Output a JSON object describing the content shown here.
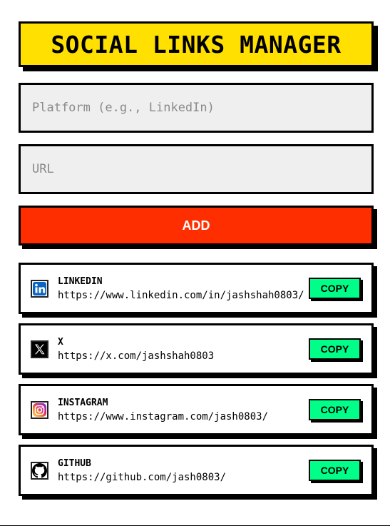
{
  "app": {
    "title": "SOCIAL LINKS MANAGER"
  },
  "form": {
    "platform_placeholder": "Platform (e.g., LinkedIn)",
    "platform_value": "",
    "url_placeholder": "URL",
    "url_value": "",
    "add_label": "ADD"
  },
  "links": [
    {
      "name": "LINKEDIN",
      "url": "https://www.linkedin.com/in/jashshah0803/",
      "icon": "linkedin-icon",
      "copy_label": "COPY"
    },
    {
      "name": "X",
      "url": "https://x.com/jashshah0803",
      "icon": "x-icon",
      "copy_label": "COPY"
    },
    {
      "name": "INSTAGRAM",
      "url": "https://www.instagram.com/jash0803/",
      "icon": "instagram-icon",
      "copy_label": "COPY"
    },
    {
      "name": "GITHUB",
      "url": "https://github.com/jash0803/",
      "icon": "github-icon",
      "copy_label": "COPY"
    }
  ],
  "colors": {
    "title_bg": "#FFE000",
    "add_bg": "#FF2E00",
    "copy_bg": "#00FF88",
    "field_bg": "#EFEFEF"
  }
}
